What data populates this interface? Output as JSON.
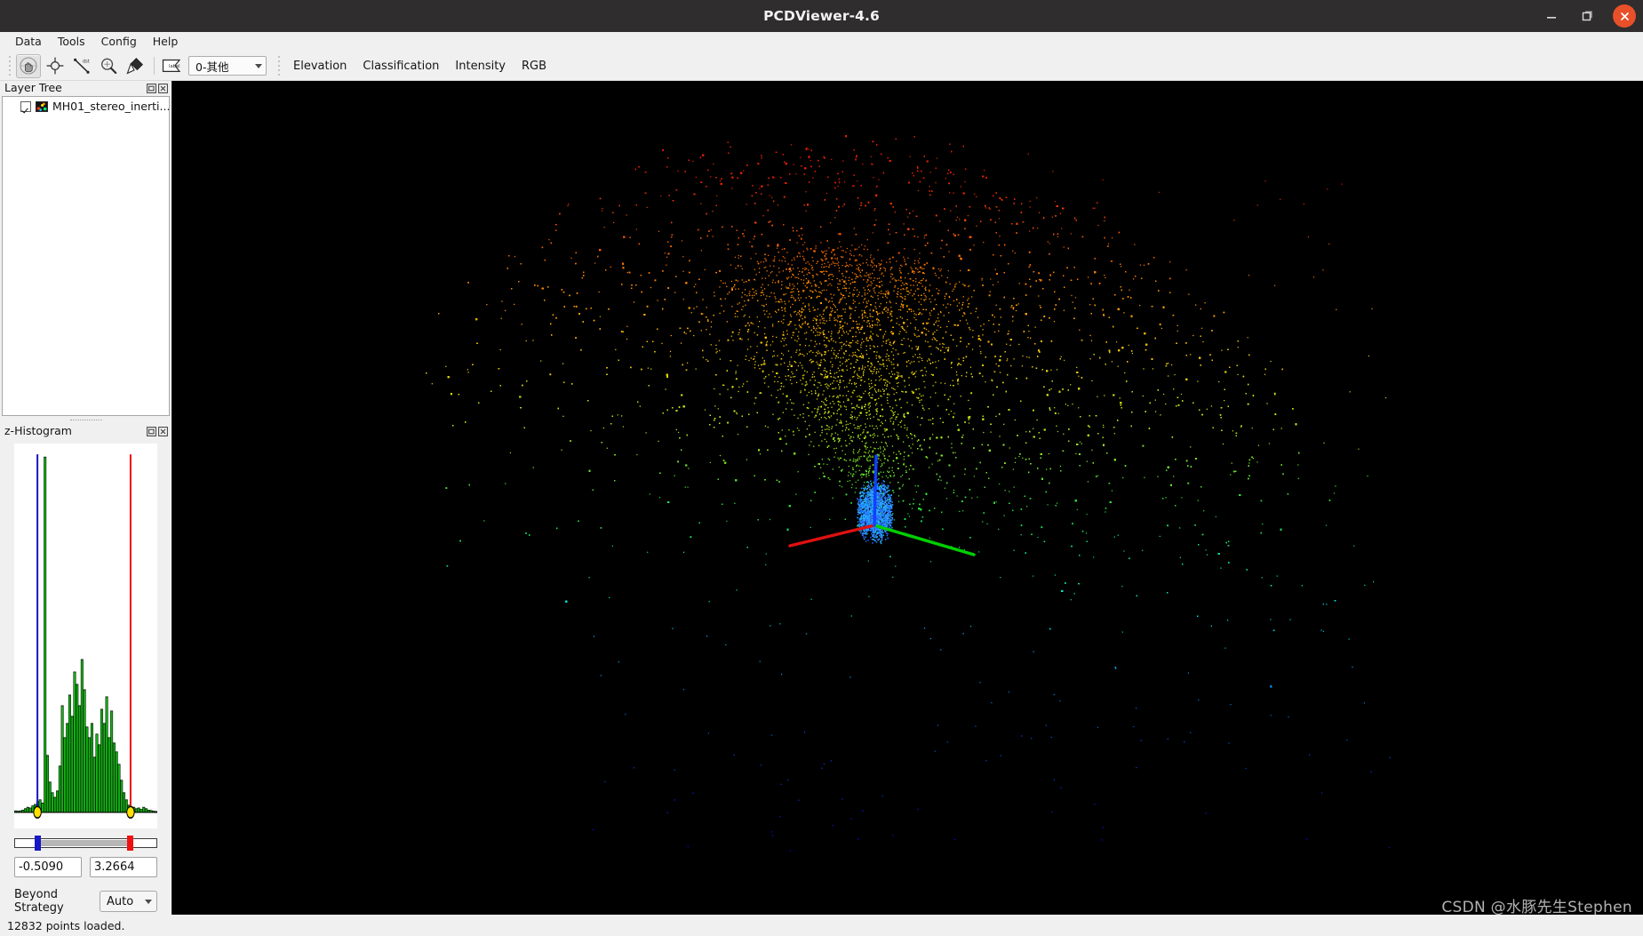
{
  "window": {
    "title": "PCDViewer-4.6",
    "minimize_icon": "minimize-icon",
    "maximize_icon": "maximize-icon",
    "close_icon": "close-icon",
    "titlebar_color": "#2f2d2d",
    "close_color": "#e8502a"
  },
  "menubar": {
    "items": [
      {
        "label": "Data"
      },
      {
        "label": "Tools"
      },
      {
        "label": "Config"
      },
      {
        "label": "Help"
      }
    ]
  },
  "toolbar": {
    "buttons": [
      {
        "name": "pan-hand-tool",
        "icon": "hand-pan-icon",
        "checked": true
      },
      {
        "name": "pick-point-tool",
        "icon": "crosshair-target-icon",
        "checked": false
      },
      {
        "name": "distance-measure-tool",
        "icon": "distance-ruler-icon",
        "checked": false
      },
      {
        "name": "zoom-tool",
        "icon": "magnifier-icon",
        "checked": false
      },
      {
        "name": "area-select-tool",
        "icon": "polygon-fill-icon",
        "checked": false
      },
      {
        "name": "label-tool",
        "icon": "label-flag-icon",
        "checked": false
      }
    ],
    "class_combo": {
      "value": "0-其他",
      "options": [
        "0-其他"
      ]
    },
    "color_modes": [
      {
        "label": "Elevation"
      },
      {
        "label": "Classification"
      },
      {
        "label": "Intensity"
      },
      {
        "label": "RGB"
      }
    ]
  },
  "layer_tree": {
    "title": "Layer Tree",
    "float_icon": "float-window-icon",
    "close_icon": "close-panel-icon",
    "items": [
      {
        "label": "MH01_stereo_inerti...",
        "checked": true,
        "thumb": "point-cloud-thumb-icon"
      }
    ]
  },
  "histogram_panel": {
    "title": "z-Histogram",
    "float_icon": "float-window-icon",
    "close_icon": "close-panel-icon",
    "min_value": "-0.5090",
    "max_value": "3.2664",
    "strategy_label": "Beyond Strategy",
    "strategy_value": "Auto",
    "strategy_options": [
      "Auto"
    ],
    "marker_low_color": "#1717c8",
    "marker_high_color": "#f01010",
    "bar_color": "#12b012"
  },
  "chart_data": {
    "type": "bar",
    "title": "z-Histogram",
    "xlabel": "",
    "ylabel": "",
    "grid": false,
    "legend": "none",
    "xlim": [
      -1.45,
      4.35
    ],
    "ylim": [
      0,
      1
    ],
    "bar_color": "#12b012",
    "bar_edge_color": "#000000",
    "markers": {
      "low_line_value": -0.509,
      "low_line_color": "#1717c8",
      "high_line_value": 3.2664,
      "high_line_color": "#f01010",
      "handle_color": "#ffe000"
    },
    "x": [
      -1.4,
      -1.3,
      -1.2,
      -1.1,
      -1.0,
      -0.9,
      -0.8,
      -0.7,
      -0.6,
      -0.5,
      -0.4,
      -0.3,
      -0.2,
      -0.1,
      0.0,
      0.1,
      0.2,
      0.3,
      0.4,
      0.5,
      0.6,
      0.7,
      0.8,
      0.9,
      1.0,
      1.1,
      1.2,
      1.3,
      1.4,
      1.5,
      1.6,
      1.7,
      1.8,
      1.9,
      2.0,
      2.1,
      2.2,
      2.3,
      2.4,
      2.5,
      2.6,
      2.7,
      2.8,
      2.9,
      3.0,
      3.1,
      3.2,
      3.3,
      3.4,
      3.5,
      3.6,
      3.7,
      3.8,
      3.9,
      4.0,
      4.1,
      4.2,
      4.3
    ],
    "values": [
      0.004,
      0.003,
      0.004,
      0.006,
      0.01,
      0.014,
      0.012,
      0.018,
      0.022,
      0.03,
      0.035,
      0.026,
      1.0,
      0.16,
      0.085,
      0.055,
      0.042,
      0.06,
      0.13,
      0.3,
      0.21,
      0.25,
      0.33,
      0.27,
      0.395,
      0.36,
      0.3,
      0.43,
      0.345,
      0.24,
      0.21,
      0.25,
      0.155,
      0.22,
      0.19,
      0.29,
      0.25,
      0.325,
      0.21,
      0.285,
      0.195,
      0.17,
      0.135,
      0.09,
      0.055,
      0.035,
      0.02,
      0.016,
      0.014,
      0.01,
      0.012,
      0.008,
      0.014,
      0.01,
      0.006,
      0.005,
      0.003,
      0.002
    ]
  },
  "viewport": {
    "name": "point-cloud-3d-viewport",
    "background": "#000000",
    "axis_gizmo": {
      "x_axis_color": "#e01010",
      "y_axis_color": "#00d000",
      "z_axis_color": "#1040ff"
    }
  },
  "watermark": {
    "text": "CSDN @水豚先生Stephen"
  },
  "statusbar": {
    "message": "12832 points loaded."
  }
}
